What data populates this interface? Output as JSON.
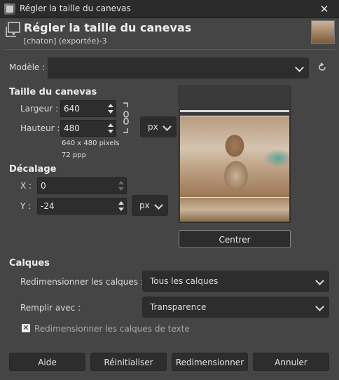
{
  "window": {
    "title": "Régler la taille du canevas",
    "close_glyph": "✕"
  },
  "header": {
    "title": "Régler la taille du canevas",
    "subtitle": "[chaton] (exportée)-3"
  },
  "template": {
    "label": "Modèle :",
    "value": ""
  },
  "canvas_size": {
    "section_title": "Taille du canevas",
    "width_label": "Largeur :",
    "width_value": "640",
    "height_label": "Hauteur :",
    "height_value": "480",
    "unit": "px",
    "info_pixels": "640 x 480 pixels",
    "info_ppp": "72 ppp"
  },
  "offset": {
    "section_title": "Décalage",
    "x_label": "X :",
    "x_value": "0",
    "y_label": "Y :",
    "y_value": "-24",
    "unit": "px"
  },
  "preview": {
    "center_button": "Centrer"
  },
  "layers": {
    "section_title": "Calques",
    "resize_label": "Redimensionner les calques :",
    "resize_value": "Tous les calques",
    "fill_label": "Remplir avec :",
    "fill_value": "Transparence",
    "resize_text_layers_label": "Redimensionner les calques de texte",
    "resize_text_layers_checked": true
  },
  "buttons": {
    "help": "Aide",
    "reset": "Réinitialiser",
    "resize": "Redimensionner",
    "cancel": "Annuler"
  },
  "icons": [
    "app-icon",
    "close-icon",
    "canvas-size-icon",
    "image-thumbnail",
    "reset-icon",
    "chevron-down-icon",
    "chain-link-icon",
    "spin-up-icon",
    "spin-down-icon",
    "checkmark-icon"
  ]
}
